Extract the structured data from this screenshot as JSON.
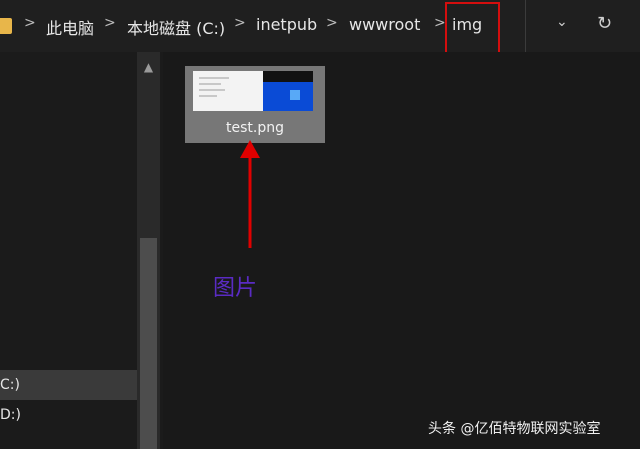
{
  "breadcrumb": {
    "items": [
      "此电脑",
      "本地磁盘 (C:)",
      "inetpub",
      "wwwroot",
      "img"
    ],
    "separator": ">"
  },
  "address_controls": {
    "dropdown_glyph": "⌄",
    "refresh_glyph": "↻"
  },
  "nav_pane": {
    "items": [
      {
        "label": "C:)",
        "selected": true
      },
      {
        "label": "D:)",
        "selected": false
      }
    ]
  },
  "file": {
    "name": "test.png",
    "selected": true
  },
  "annotation": {
    "caption": "图片",
    "color": "#5a2bc4",
    "arrow_color": "#e00000",
    "box_color": "#d40e0e"
  },
  "watermark": "头条 @亿佰特物联网实验室"
}
